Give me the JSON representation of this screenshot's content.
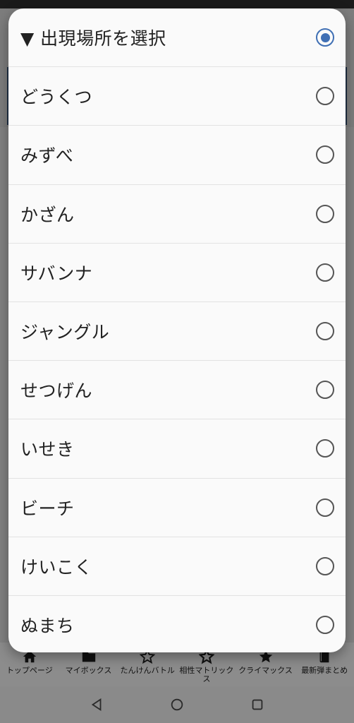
{
  "dialog": {
    "options": [
      {
        "label": "▼ 出現場所を選択",
        "checked": true
      },
      {
        "label": "どうくつ",
        "checked": false
      },
      {
        "label": "みずべ",
        "checked": false
      },
      {
        "label": "かざん",
        "checked": false
      },
      {
        "label": "サバンナ",
        "checked": false
      },
      {
        "label": "ジャングル",
        "checked": false
      },
      {
        "label": "せつげん",
        "checked": false
      },
      {
        "label": "いせき",
        "checked": false
      },
      {
        "label": "ビーチ",
        "checked": false
      },
      {
        "label": "けいこく",
        "checked": false
      },
      {
        "label": "ぬまち",
        "checked": false
      }
    ]
  },
  "bottom_nav": {
    "items": [
      {
        "label": "トップページ",
        "icon": "home-icon"
      },
      {
        "label": "マイボックス",
        "icon": "folder-icon"
      },
      {
        "label": "たんけんバトル",
        "icon": "star-outline-icon"
      },
      {
        "label": "相性マトリックス",
        "icon": "star-outline-icon"
      },
      {
        "label": "クライマックス",
        "icon": "star-filled-icon"
      },
      {
        "label": "最新弾まとめ",
        "icon": "book-icon"
      }
    ]
  },
  "colors": {
    "accent": "#3f6fb4",
    "dialog_bg": "#fafafa"
  }
}
